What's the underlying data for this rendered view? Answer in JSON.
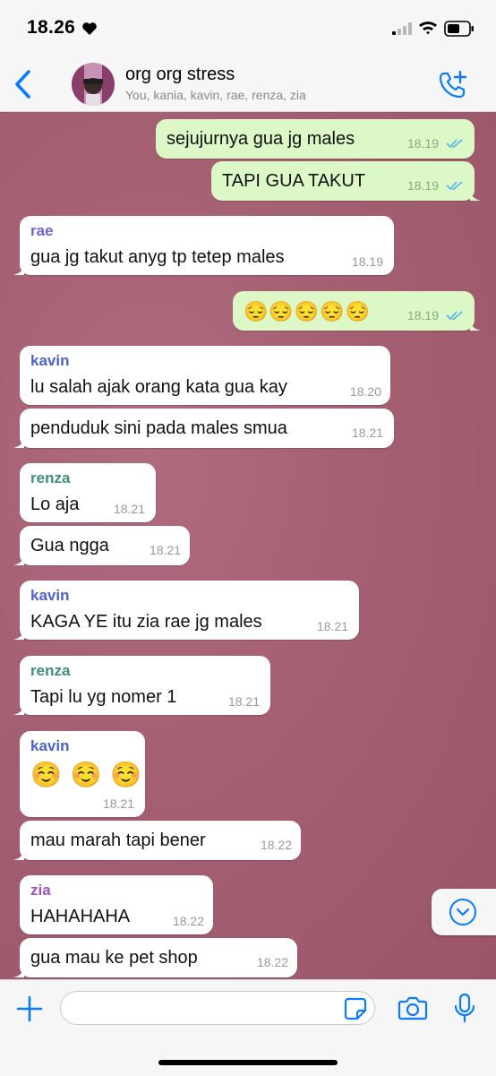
{
  "status_bar": {
    "time": "18.26"
  },
  "header": {
    "title": "org org stress",
    "members": "You, kania, kavin, rae, renza, zia"
  },
  "messages": [
    {
      "direction": "out",
      "text": "sejujurnya gua jg males",
      "time": "18.19",
      "read": true
    },
    {
      "direction": "out",
      "text": "TAPI GUA TAKUT",
      "time": "18.19",
      "read": true
    },
    {
      "direction": "in",
      "sender": "rae",
      "sender_color": "#6f62d6",
      "text": "gua jg takut anyg tp tetep males",
      "time": "18.19"
    },
    {
      "direction": "out",
      "text": "😔😔😔😔😔",
      "time": "18.19",
      "read": true
    },
    {
      "direction": "in",
      "sender": "kavin",
      "sender_color": "#4b63c8",
      "text": "lu salah ajak orang kata gua kay",
      "time": "18.20"
    },
    {
      "direction": "in",
      "text": "penduduk sini pada males smua",
      "time": "18.21"
    },
    {
      "direction": "in",
      "sender": "renza",
      "sender_color": "#3f8f7b",
      "text": "Lo aja",
      "time": "18.21"
    },
    {
      "direction": "in",
      "text": "Gua ngga",
      "time": "18.21"
    },
    {
      "direction": "in",
      "sender": "kavin",
      "sender_color": "#4b63c8",
      "text": "KAGA YE itu zia rae jg males",
      "time": "18.21"
    },
    {
      "direction": "in",
      "sender": "renza",
      "sender_color": "#3f8f7b",
      "text": "Tapi lu yg nomer 1",
      "time": "18.21"
    },
    {
      "direction": "in",
      "sender": "kavin",
      "sender_color": "#4b63c8",
      "text": "☺️ ☺️ ☺️",
      "time": "18.21"
    },
    {
      "direction": "in",
      "text": "mau marah tapi bener",
      "time": "18.22"
    },
    {
      "direction": "in",
      "sender": "zia",
      "sender_color": "#a24fc2",
      "text": "HAHAHAHA",
      "time": "18.22"
    },
    {
      "direction": "in",
      "text": "gua mau ke pet shop",
      "time": "18.22"
    }
  ],
  "input": {
    "value": "",
    "placeholder": ""
  },
  "colors": {
    "accent": "#0a7bff",
    "outgoing_bubble": "#dcf8c6",
    "incoming_bubble": "#ffffff",
    "read_ticks": "#4fb6ec",
    "wallpaper": "#a55f73"
  },
  "icons": [
    "heart-icon",
    "signal-icon",
    "wifi-icon",
    "battery-icon",
    "back-chevron-icon",
    "add-call-icon",
    "chevron-down-icon",
    "plus-icon",
    "sticker-icon",
    "camera-icon",
    "microphone-icon"
  ]
}
